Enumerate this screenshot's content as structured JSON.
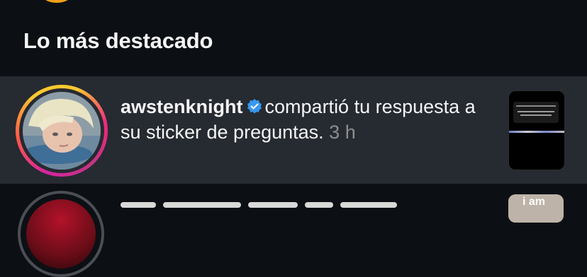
{
  "section": {
    "title": "Lo más destacado"
  },
  "notification": {
    "username": "awstenknight",
    "action_text": "compartió tu respuesta a su sticker de preguntas.",
    "time": "3 h",
    "verified": true,
    "colors": {
      "row_bg": "#262a31",
      "time": "#8e8e8e",
      "verified": "#3797f0"
    }
  },
  "next_item": {
    "thumbnail_text": "i am"
  },
  "icons": [
    "verified-badge-icon",
    "story-ring"
  ]
}
